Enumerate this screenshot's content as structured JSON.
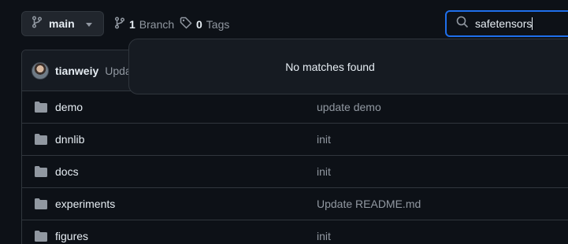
{
  "branch_selector": {
    "name": "main"
  },
  "repo_meta": {
    "branches_count": "1",
    "branches_label": "Branch",
    "tags_count": "0",
    "tags_label": "Tags"
  },
  "search": {
    "value": "safetensors"
  },
  "dropdown": {
    "message": "No matches found"
  },
  "latest_commit": {
    "author": "tianweiy",
    "message": "Upda"
  },
  "files": [
    {
      "name": "demo",
      "message": "update demo",
      "icon": "folder-icon"
    },
    {
      "name": "dnnlib",
      "message": "init",
      "icon": "folder-icon"
    },
    {
      "name": "docs",
      "message": "init",
      "icon": "folder-icon"
    },
    {
      "name": "experiments",
      "message": "Update README.md",
      "icon": "folder-icon"
    },
    {
      "name": "figures",
      "message": "init",
      "icon": "folder-icon"
    }
  ],
  "colors": {
    "background": "#0d1117",
    "panel": "#161b22",
    "border": "#30363d",
    "focus_accent": "#1f6feb",
    "text_primary": "#e6edf3",
    "text_muted": "#9198a1",
    "folder": "#9198a1"
  }
}
